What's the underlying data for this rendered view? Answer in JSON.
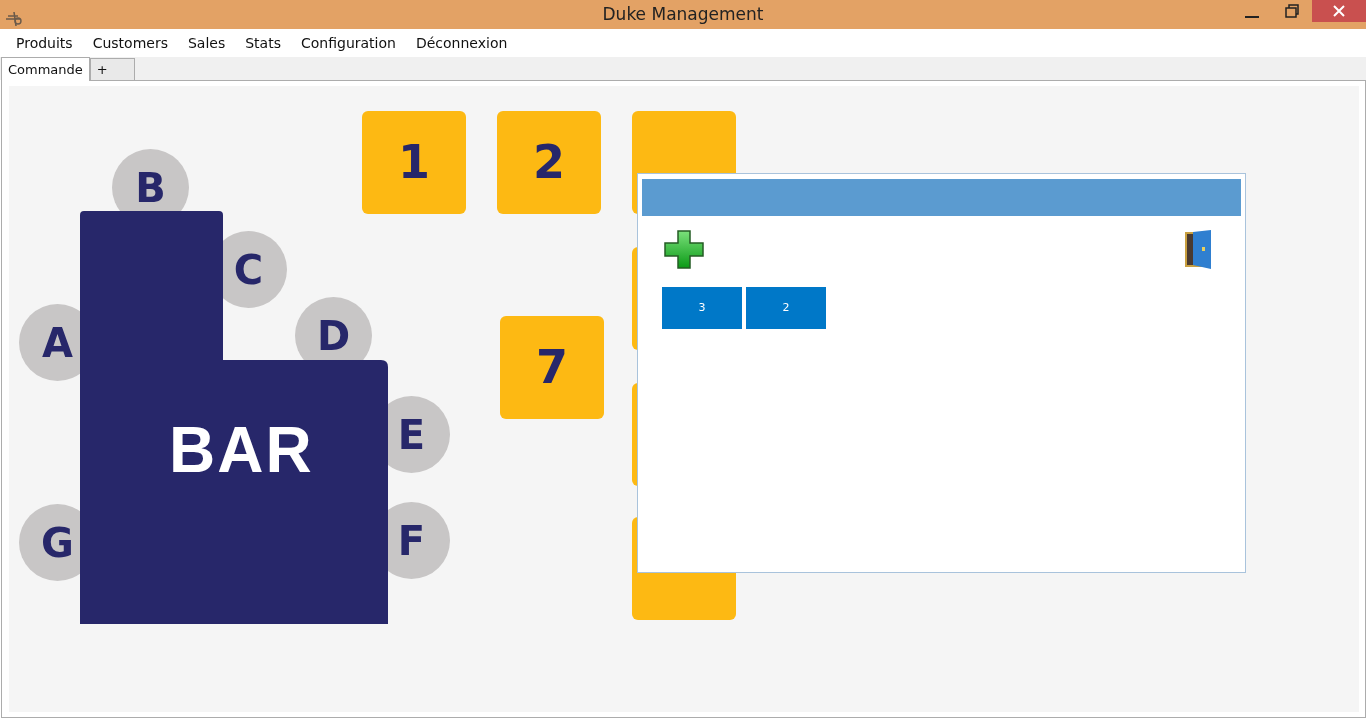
{
  "window": {
    "title": "Duke Management"
  },
  "menu": [
    "Produits",
    "Customers",
    "Sales",
    "Stats",
    "Configuration",
    "Déconnexion"
  ],
  "tabs": [
    {
      "label": "Commande",
      "selected": true
    },
    {
      "label": "+",
      "selected": false
    }
  ],
  "floor": {
    "bar": {
      "label": "BAR"
    },
    "seats": [
      "B",
      "C",
      "A",
      "D",
      "E",
      "F",
      "G"
    ],
    "tables": [
      {
        "kind": "number",
        "label": "1"
      },
      {
        "kind": "number",
        "label": "2"
      },
      {
        "kind": "covered"
      },
      {
        "kind": "covered"
      },
      {
        "kind": "covered"
      },
      {
        "kind": "covered"
      },
      {
        "kind": "number",
        "label": "7"
      }
    ]
  },
  "dialog": {
    "orders": [
      "3",
      "2"
    ]
  }
}
